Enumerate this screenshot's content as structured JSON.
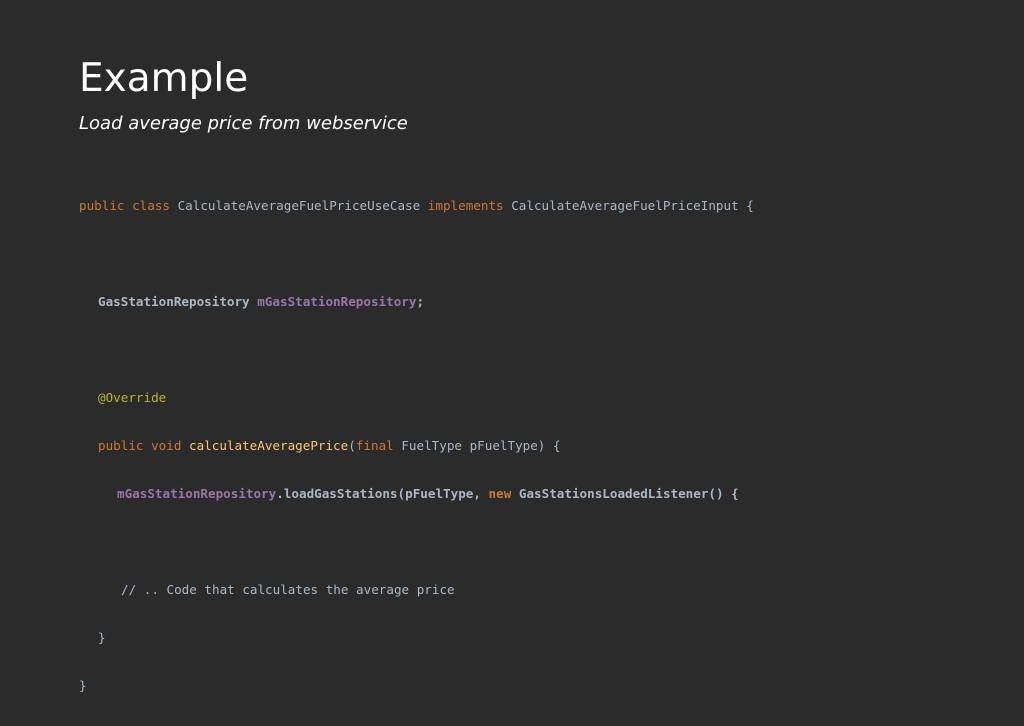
{
  "slide": {
    "title": "Example",
    "subtitle": "Load average price from webservice"
  },
  "code": {
    "line1": {
      "kw1": "public class",
      "name": " CalculateAverageFuelPriceUseCase ",
      "kw2": "implements",
      "rest": " CalculateAverageFuelPriceInput {"
    },
    "line2": {
      "type": "GasStationRepository ",
      "field": "mGasStationRepository",
      "end": ";"
    },
    "line3": {
      "annotation": "@Override"
    },
    "line4": {
      "kw1": "public void",
      "space": " ",
      "fn": "calculateAveragePrice",
      "open": "(",
      "kw2": "final",
      "rest": " FuelType pFuelType) {"
    },
    "line5": {
      "field": "mGasStationRepository",
      "call": ".loadGasStations(pFuelType, ",
      "kw": "new",
      "rest": " GasStationsLoadedListener() {"
    },
    "line6": {
      "comment": "// .. Code that calculates the average price"
    },
    "line7": {
      "brace": "}"
    },
    "line8": {
      "brace": "}"
    }
  }
}
